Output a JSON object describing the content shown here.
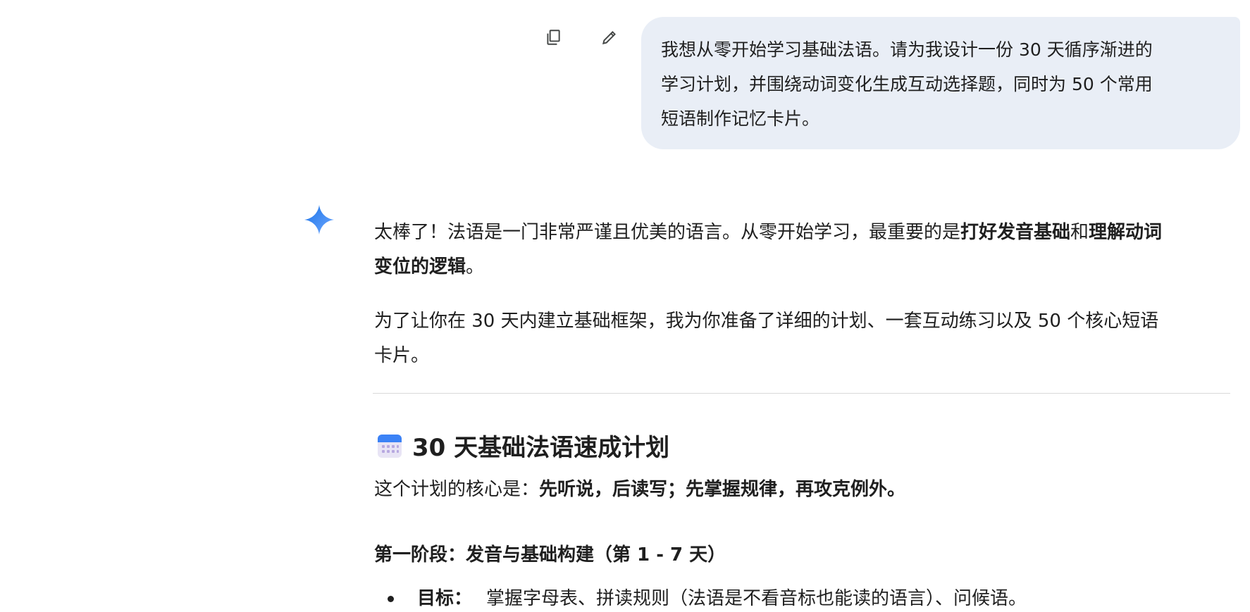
{
  "user_message": {
    "lines": [
      "我想从零开始学习基础法语。请为我设计一份 30 天循序渐进的",
      "学习计划，并围绕动词变化生成互动选择题，同时为 50 个常用",
      "短语制作记忆卡片。"
    ],
    "actions": {
      "copy_icon": "copy-icon",
      "edit_icon": "edit-icon"
    }
  },
  "response": {
    "para1": {
      "line1_a": "太棒了！法语是一门非常严谨且优美的语言。从零开始学习，最重要的是",
      "line1_b": "打好发音基础",
      "line1_c": "和",
      "line1_d": "理解动词",
      "line2_a": "变位的逻辑",
      "line2_b": "。"
    },
    "para2": {
      "line1": "为了让你在 30 天内建立基础框架，我为你准备了详细的计划、一套互动练习以及 50 个核心短语",
      "line2": "卡片。"
    },
    "heading": "30 天基础法语速成计划",
    "core": {
      "prefix": "这个计划的核心是：",
      "bold": "先听说，后读写；先掌握规律，再攻克例外。"
    },
    "stage1": "第一阶段：发音与基础构建（第 1 - 7 天）",
    "bullet1": {
      "label": "目标：",
      "text": "掌握字母表、拼读规则（法语是不看音标也能读的语言）、问候语。"
    }
  },
  "colors": {
    "bubble_bg": "#e9eef6",
    "text": "#1f1f1f",
    "divider": "#d9d9d9",
    "spark_blue": "#4285f4"
  }
}
